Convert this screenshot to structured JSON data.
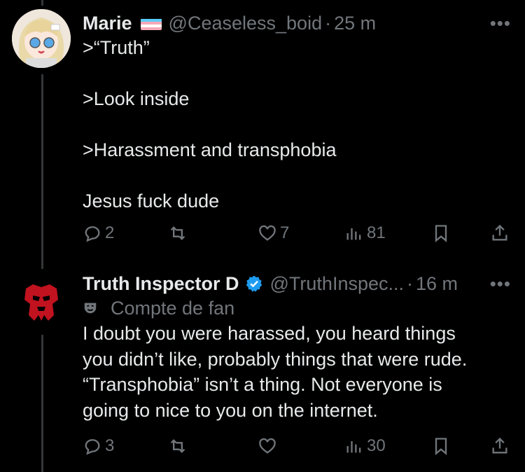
{
  "tweets": [
    {
      "name": "Marie",
      "handle": "@Ceaseless_boid",
      "separator": "·",
      "time": "25 m",
      "more": "•••",
      "text": ">“Truth”\n\n>Look inside\n\n>Harassment and transphobia\n\nJesus fuck dude",
      "stats": {
        "replies": "2",
        "retweets": "",
        "likes": "7",
        "views": "81"
      }
    },
    {
      "name": "Truth Inspector D",
      "handle": "@TruthInspec...",
      "separator": "·",
      "time": "16 m",
      "more": "•••",
      "label": "Compte de fan",
      "text": "I doubt you were harassed, you heard things\nyou didn’t like, probably things that were rude.\n“Transphobia” isn’t a thing. Not everyone is\ngoing to nice to you on the internet.",
      "stats": {
        "replies": "3",
        "retweets": "",
        "likes": "",
        "views": "30"
      }
    }
  ],
  "colors": {
    "background": "#000000",
    "text": "#e7e9ea",
    "muted": "#71767b",
    "verified": "#1d9bf0",
    "avatar2": "#c1121f"
  },
  "icons": [
    "reply-icon",
    "retweet-icon",
    "like-icon",
    "views-icon",
    "bookmark-icon",
    "share-icon",
    "trans-flag-icon",
    "verified-badge-icon",
    "mask-icon"
  ]
}
